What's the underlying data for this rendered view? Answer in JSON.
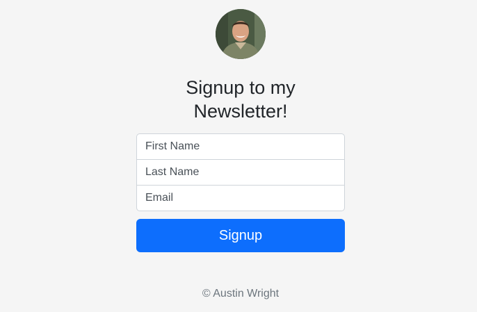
{
  "header": {
    "avatar_icon": "profile-photo",
    "title_line1": "Signup to my",
    "title_line2": "Newsletter!"
  },
  "form": {
    "first_name_placeholder": "First Name",
    "last_name_placeholder": "Last Name",
    "email_placeholder": "Email",
    "submit_label": "Signup"
  },
  "footer": {
    "copyright": "© Austin Wright"
  },
  "colors": {
    "background": "#f5f5f5",
    "primary_button": "#0d6efd",
    "button_text": "#ffffff"
  }
}
